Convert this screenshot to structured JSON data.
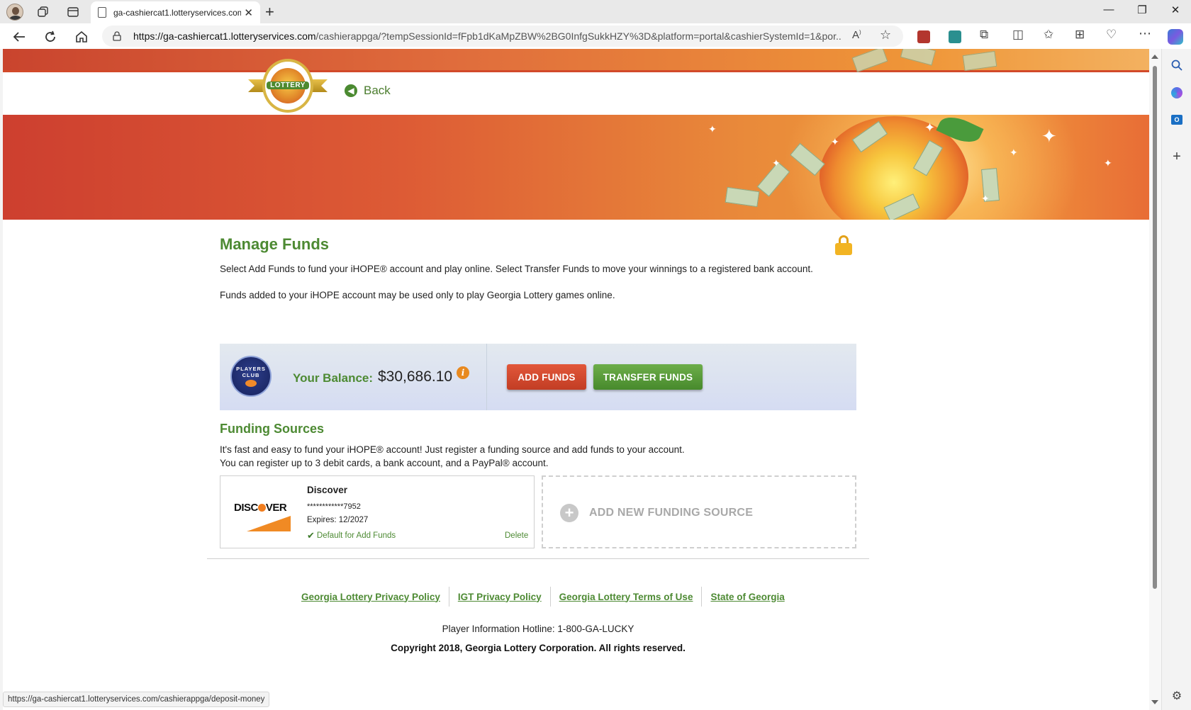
{
  "browser": {
    "tab_title": "ga-cashiercat1.lotteryservices.com",
    "url_host": "https://ga-cashiercat1.lotteryservices.com",
    "url_path": "/cashierappga/?tempSessionId=fFpb1dKaMpZBW%2BG0InfgSukkHZY%3D&platform=portal&cashierSystemId=1&por...",
    "status_url": "https://ga-cashiercat1.lotteryservices.com/cashierappga/deposit-money"
  },
  "header": {
    "logo_text": "LOTTERY",
    "back_label": "Back"
  },
  "manage_funds": {
    "title": "Manage Funds",
    "intro1": "Select Add Funds to fund your iHOPE® account and play online. Select Transfer Funds to move your winnings to a registered bank account.",
    "intro2": "Funds added to your iHOPE account may be used only to play Georgia Lottery games online."
  },
  "balance": {
    "club_line1": "PLAYERS",
    "club_line2": "CLUB",
    "label": "Your Balance:",
    "value": "$30,686.10",
    "info_glyph": "i",
    "add_funds_label": "ADD FUNDS",
    "transfer_funds_label": "TRANSFER FUNDS"
  },
  "funding_sources": {
    "title": "Funding Sources",
    "desc1": "It's fast and easy to fund your iHOPE® account! Just register a funding source and add funds to your account.",
    "desc2": "You can register up to 3 debit cards, a bank account, and a PayPal® account.",
    "card": {
      "brand_logo": "DISC",
      "brand_logo_end": "VER",
      "name": "Discover",
      "masked_number": "************7952",
      "expires": "Expires: 12/2027",
      "default_label": "Default for Add Funds",
      "delete_label": "Delete"
    },
    "add_new_label": "ADD NEW FUNDING SOURCE"
  },
  "footer": {
    "links": [
      "Georgia Lottery Privacy Policy",
      "IGT Privacy Policy",
      "Georgia Lottery Terms of Use",
      "State of Georgia"
    ],
    "hotline": "Player Information Hotline: 1-800-GA-LUCKY",
    "copyright": "Copyright 2018, Georgia Lottery Corporation. All rights reserved."
  },
  "colors": {
    "brand_green": "#4d8a33",
    "add_funds_red": "#c23d24",
    "transfer_green": "#478a2c"
  }
}
